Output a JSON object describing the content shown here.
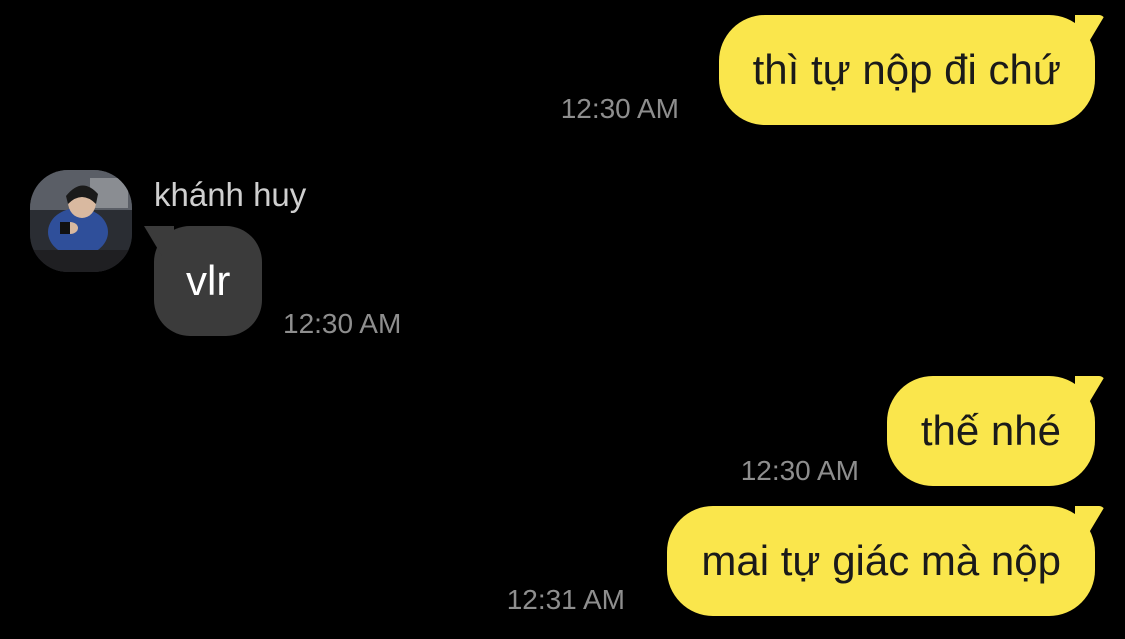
{
  "messages": [
    {
      "direction": "outgoing",
      "text": "thì tự nộp đi chứ",
      "time": "12:30 AM"
    },
    {
      "direction": "incoming",
      "sender": "khánh huy",
      "text": "vlr",
      "time": "12:30 AM"
    },
    {
      "direction": "outgoing",
      "text": "thế nhé",
      "time": "12:30 AM"
    },
    {
      "direction": "outgoing",
      "text": "mai tự giác mà nộp",
      "time": "12:31 AM"
    }
  ],
  "avatar": {
    "icon": "user-photo-avatar-icon"
  },
  "colors": {
    "background": "#000000",
    "outgoing_bubble": "#FAE64C",
    "incoming_bubble": "#3B3B3B",
    "timestamp": "#8E8E8E"
  }
}
